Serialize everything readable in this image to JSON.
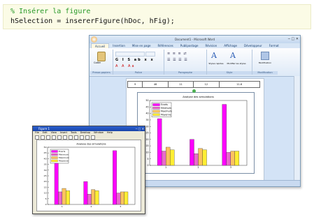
{
  "code": {
    "comment": "% Insérer la figure",
    "statement": "hSelection = insererFigure(hDoc, hFig);"
  },
  "word": {
    "title": "Document1 - Microsoft Word",
    "tabs": [
      "Accueil",
      "Insertion",
      "Mise en page",
      "Références",
      "Publipostage",
      "Révision",
      "Affichage",
      "Développeur",
      "Format"
    ],
    "groups": [
      "Presse-papiers",
      "Police",
      "Paragraphe",
      "Style",
      "Modification"
    ],
    "paste_label": "Coller",
    "styles_label": "Styles rapides",
    "change_styles_label": "Modifier les styles",
    "edit_label": "Modification",
    "table_row": [
      "9",
      "46",
      "11",
      "12",
      "11.6"
    ],
    "chart_title": "Analyse des simulations"
  },
  "figure": {
    "title": "Figure 1",
    "menu": [
      "File",
      "Edit",
      "View",
      "Insert",
      "Tools",
      "Desktop",
      "Window",
      "Help"
    ],
    "chart_title": "Analyse des simulations"
  },
  "colors": {
    "magenta": "#ff00ff",
    "orchid": "#e86acc",
    "salmon": "#f39a6e",
    "orange": "#fbc35f",
    "yellow": "#ffee33"
  },
  "chart_data": {
    "type": "bar",
    "title": "Analyse des simulations",
    "categories": [
      "1",
      "2",
      "3"
    ],
    "legend": [
      "Ecarts",
      "Minimum",
      "Maximum",
      "Moyenne"
    ],
    "series": [
      {
        "name": "Ecarts",
        "values": [
          36,
          20,
          47
        ]
      },
      {
        "name": "Minimum",
        "values": [
          11,
          9,
          10
        ]
      },
      {
        "name": "Maximum",
        "values": [
          14,
          13,
          11
        ]
      },
      {
        "name": "Moyenne",
        "values": [
          12,
          12,
          11
        ]
      }
    ],
    "ylim": [
      0,
      50
    ],
    "yticks": [
      "0",
      "5",
      "10",
      "15",
      "20",
      "25",
      "30",
      "35",
      "40",
      "45",
      "50"
    ]
  }
}
